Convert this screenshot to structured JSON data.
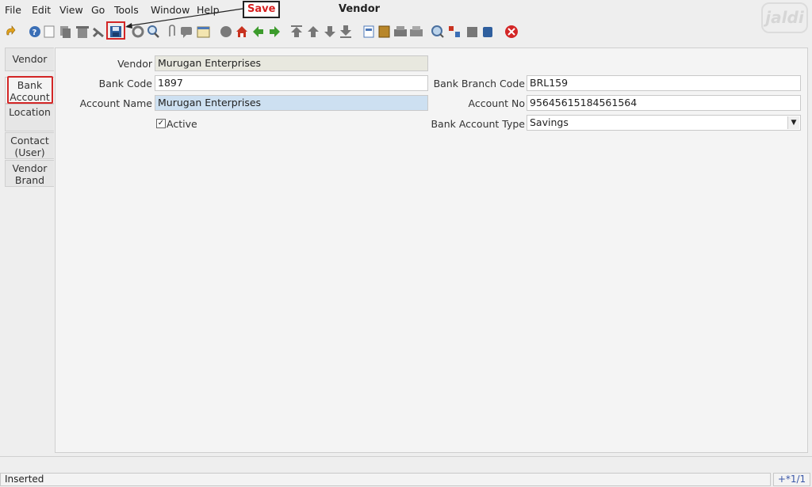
{
  "menu": {
    "file": "File",
    "edit": "Edit",
    "view": "View",
    "go": "Go",
    "tools": "Tools",
    "window": "Window",
    "help": "Help"
  },
  "window_title": "Vendor",
  "logo_text": "jaldi",
  "annotation": {
    "save_label": "Save"
  },
  "toolbar_icons": [
    "undo-icon",
    "help-icon",
    "new-icon",
    "copy-icon",
    "delete-icon",
    "delete-selection-icon",
    "save-icon",
    "refresh-icon",
    "find-icon",
    "attachment-icon",
    "chat-icon",
    "history-icon",
    "home-icon",
    "parent-icon",
    "back-icon",
    "forward-icon",
    "first-record-icon",
    "previous-record-icon",
    "next-record-icon",
    "last-record-icon",
    "report-icon",
    "archive-icon",
    "print-icon",
    "print-preview-icon",
    "zoom-across-icon",
    "workflow-icon",
    "product-info-icon",
    "end-icon",
    "exit-icon"
  ],
  "tabs": [
    {
      "label_line1": "Vendor",
      "label_line2": ""
    },
    {
      "label_line1": "Bank",
      "label_line2": "Account"
    },
    {
      "label_line1": "Location",
      "label_line2": ""
    },
    {
      "label_line1": "Contact",
      "label_line2": "(User)"
    },
    {
      "label_line1": "Vendor",
      "label_line2": "Brand"
    }
  ],
  "form": {
    "vendor_label": "Vendor",
    "vendor_value": "Murugan Enterprises",
    "bank_code_label": "Bank Code",
    "bank_code_value": "1897",
    "account_name_label": "Account Name",
    "account_name_value": "Murugan Enterprises",
    "active_label": "Active",
    "active_checked": true,
    "bank_branch_code_label": "Bank Branch Code",
    "bank_branch_code_value": "BRL159",
    "account_no_label": "Account No",
    "account_no_value": "95645615184561564",
    "bank_account_type_label": "Bank Account Type",
    "bank_account_type_value": "Savings"
  },
  "status": {
    "message": "Inserted",
    "record": "+*1/1"
  }
}
